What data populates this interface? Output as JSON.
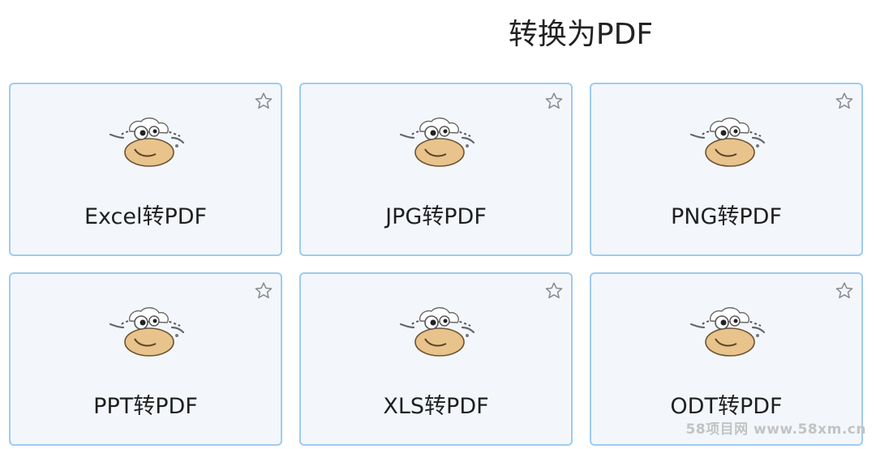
{
  "page": {
    "title": "转换为PDF"
  },
  "cards": [
    {
      "label": "Excel转PDF",
      "icon": "mascot-icon",
      "favorite_icon": "star-outline-icon"
    },
    {
      "label": "JPG转PDF",
      "icon": "mascot-icon",
      "favorite_icon": "star-outline-icon"
    },
    {
      "label": "PNG转PDF",
      "icon": "mascot-icon",
      "favorite_icon": "star-outline-icon"
    },
    {
      "label": "PPT转PDF",
      "icon": "mascot-icon",
      "favorite_icon": "star-outline-icon"
    },
    {
      "label": "XLS转PDF",
      "icon": "mascot-icon",
      "favorite_icon": "star-outline-icon"
    },
    {
      "label": "ODT转PDF",
      "icon": "mascot-icon",
      "favorite_icon": "star-outline-icon"
    }
  ],
  "watermark": "58项目网 www.58xm.cn",
  "colors": {
    "card_border": "#9fcbef",
    "card_background": "#f3f7fc",
    "text": "#1f1f1f",
    "star": "#8a8a8a",
    "mascot_body": "#e8c38b"
  }
}
